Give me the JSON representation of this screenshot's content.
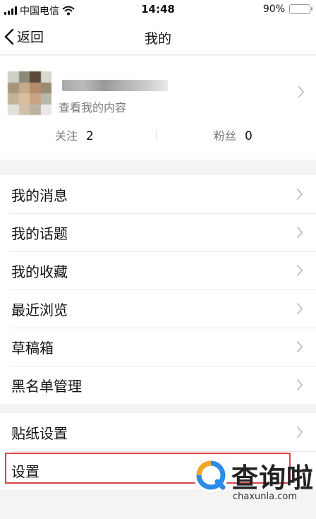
{
  "status_bar": {
    "carrier": "中国电信",
    "time": "14:48",
    "battery_percent": "90%",
    "battery_level": 0.9
  },
  "nav": {
    "back_label": "返回",
    "title": "我的"
  },
  "profile": {
    "subtitle": "查看我的内容",
    "follow_label": "关注",
    "follow_count": "2",
    "fans_label": "粉丝",
    "fans_count": "0"
  },
  "menu_group_1": {
    "items": [
      "我的消息",
      "我的话题",
      "我的收藏",
      "最近浏览",
      "草稿箱",
      "黑名单管理"
    ]
  },
  "menu_group_2": {
    "items": [
      "贴纸设置",
      "设置"
    ]
  },
  "watermark": {
    "text": "查询啦",
    "url": "chaxunla.com"
  },
  "colors": {
    "highlight": "#d9444a",
    "battery": "#3ec33e",
    "logo_orange": "#f5a623",
    "logo_blue": "#2a8be8"
  }
}
